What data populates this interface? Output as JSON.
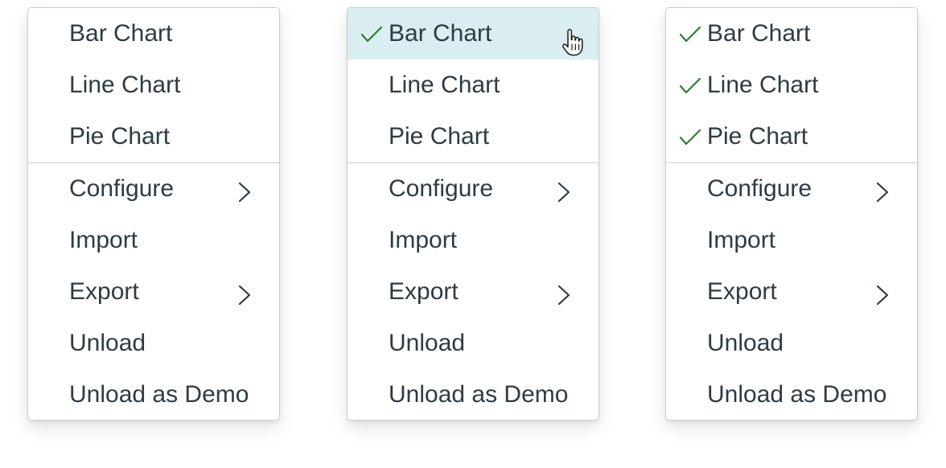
{
  "menus": [
    {
      "name": "menu-unchecked",
      "group1": [
        {
          "label": "Bar Chart",
          "checked": false
        },
        {
          "label": "Line Chart",
          "checked": false
        },
        {
          "label": "Pie Chart",
          "checked": false
        }
      ],
      "group2": [
        {
          "label": "Configure",
          "submenu": true
        },
        {
          "label": "Import",
          "submenu": false
        },
        {
          "label": "Export",
          "submenu": true
        },
        {
          "label": "Unload",
          "submenu": false
        },
        {
          "label": "Unload as Demo",
          "submenu": false
        }
      ]
    },
    {
      "name": "menu-one-checked",
      "group1": [
        {
          "label": "Bar Chart",
          "checked": true,
          "hovered": true
        },
        {
          "label": "Line Chart",
          "checked": false
        },
        {
          "label": "Pie Chart",
          "checked": false
        }
      ],
      "group2": [
        {
          "label": "Configure",
          "submenu": true
        },
        {
          "label": "Import",
          "submenu": false
        },
        {
          "label": "Export",
          "submenu": true
        },
        {
          "label": "Unload",
          "submenu": false
        },
        {
          "label": "Unload as Demo",
          "submenu": false
        }
      ]
    },
    {
      "name": "menu-all-checked",
      "group1": [
        {
          "label": "Bar Chart",
          "checked": true
        },
        {
          "label": "Line Chart",
          "checked": true
        },
        {
          "label": "Pie Chart",
          "checked": true
        }
      ],
      "group2": [
        {
          "label": "Configure",
          "submenu": true
        },
        {
          "label": "Import",
          "submenu": false
        },
        {
          "label": "Export",
          "submenu": true
        },
        {
          "label": "Unload",
          "submenu": false
        },
        {
          "label": "Unload as Demo",
          "submenu": false
        }
      ]
    }
  ],
  "colors": {
    "text": "#2d3b45",
    "check": "#2e7d32",
    "hover_bg": "#daedf1",
    "border": "#c7cdd1"
  },
  "icons": {
    "check": "checkmark-icon",
    "submenu": "chevron-right-icon",
    "cursor": "hand-pointer-cursor-icon"
  }
}
